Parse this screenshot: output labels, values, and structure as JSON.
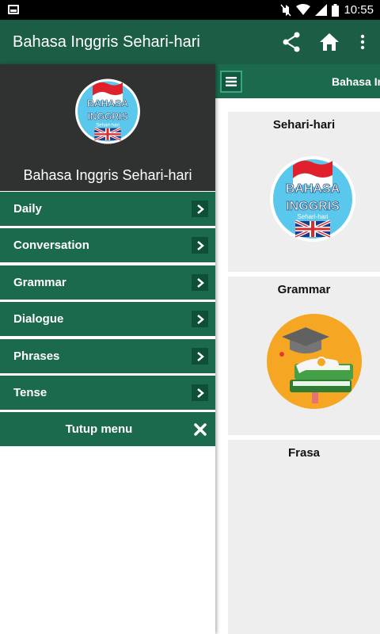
{
  "status_bar": {
    "time": "10:55",
    "icons": [
      "notification-icon",
      "mute-icon",
      "wifi-icon",
      "signal-icon",
      "battery-icon"
    ]
  },
  "app_bar": {
    "title": "Bahasa Inggris Sehari-hari",
    "actions": [
      "share-icon",
      "home-icon",
      "overflow-menu-icon"
    ]
  },
  "drawer": {
    "header_title": "Bahasa Inggris Sehari-hari",
    "logo": {
      "line1": "BAHASA",
      "line2": "INGGRIS",
      "line3": "Sehari-hari"
    },
    "items": [
      {
        "label": "Daily"
      },
      {
        "label": "Conversation"
      },
      {
        "label": "Grammar"
      },
      {
        "label": "Dialogue"
      },
      {
        "label": "Phrases"
      },
      {
        "label": "Tense"
      }
    ],
    "close_label": "Tutup menu"
  },
  "main": {
    "strip_title": "Bahasa Inggris Sehari-hari",
    "cards": [
      {
        "title": "Sehari-hari"
      },
      {
        "title": "Grammar"
      },
      {
        "title": "Frasa"
      }
    ]
  },
  "colors": {
    "primary": "#1b5e45",
    "menu_bg": "#1b6a4e",
    "drawer_header": "#2f3231",
    "card_bg": "#eeeeee"
  }
}
